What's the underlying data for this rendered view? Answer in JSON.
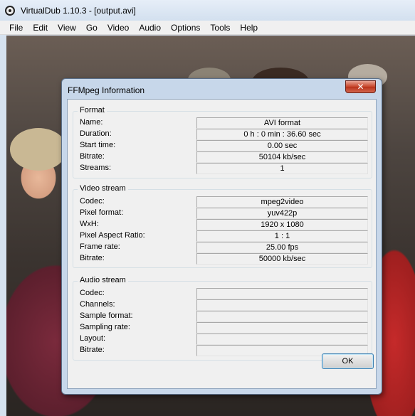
{
  "app": {
    "title": "VirtualDub 1.10.3 - [output.avi]"
  },
  "menu": [
    "File",
    "Edit",
    "View",
    "Go",
    "Video",
    "Audio",
    "Options",
    "Tools",
    "Help"
  ],
  "dialog": {
    "title": "FFMpeg Information",
    "close_label": "✕",
    "ok_label": "OK",
    "format": {
      "label": "Format",
      "rows": [
        {
          "label": "Name:",
          "value": "AVI format"
        },
        {
          "label": "Duration:",
          "value": "0 h : 0 min : 36.60 sec"
        },
        {
          "label": "Start time:",
          "value": "0.00 sec"
        },
        {
          "label": "Bitrate:",
          "value": "50104 kb/sec"
        },
        {
          "label": "Streams:",
          "value": "1"
        }
      ]
    },
    "video": {
      "label": "Video stream",
      "rows": [
        {
          "label": "Codec:",
          "value": "mpeg2video"
        },
        {
          "label": "Pixel format:",
          "value": "yuv422p"
        },
        {
          "label": "WxH:",
          "value": "1920 x 1080"
        },
        {
          "label": "Pixel Aspect Ratio:",
          "value": "1 : 1"
        },
        {
          "label": "Frame rate:",
          "value": "25.00 fps"
        },
        {
          "label": "Bitrate:",
          "value": "50000 kb/sec"
        }
      ]
    },
    "audio": {
      "label": "Audio stream",
      "rows": [
        {
          "label": "Codec:",
          "value": ""
        },
        {
          "label": "Channels:",
          "value": ""
        },
        {
          "label": "Sample format:",
          "value": ""
        },
        {
          "label": "Sampling rate:",
          "value": ""
        },
        {
          "label": "Layout:",
          "value": ""
        },
        {
          "label": "Bitrate:",
          "value": ""
        }
      ]
    }
  },
  "colors": {
    "close_button": "#c7452b",
    "dialog_frame": "#c7d7ea",
    "ok_border": "#3c7fb1"
  }
}
